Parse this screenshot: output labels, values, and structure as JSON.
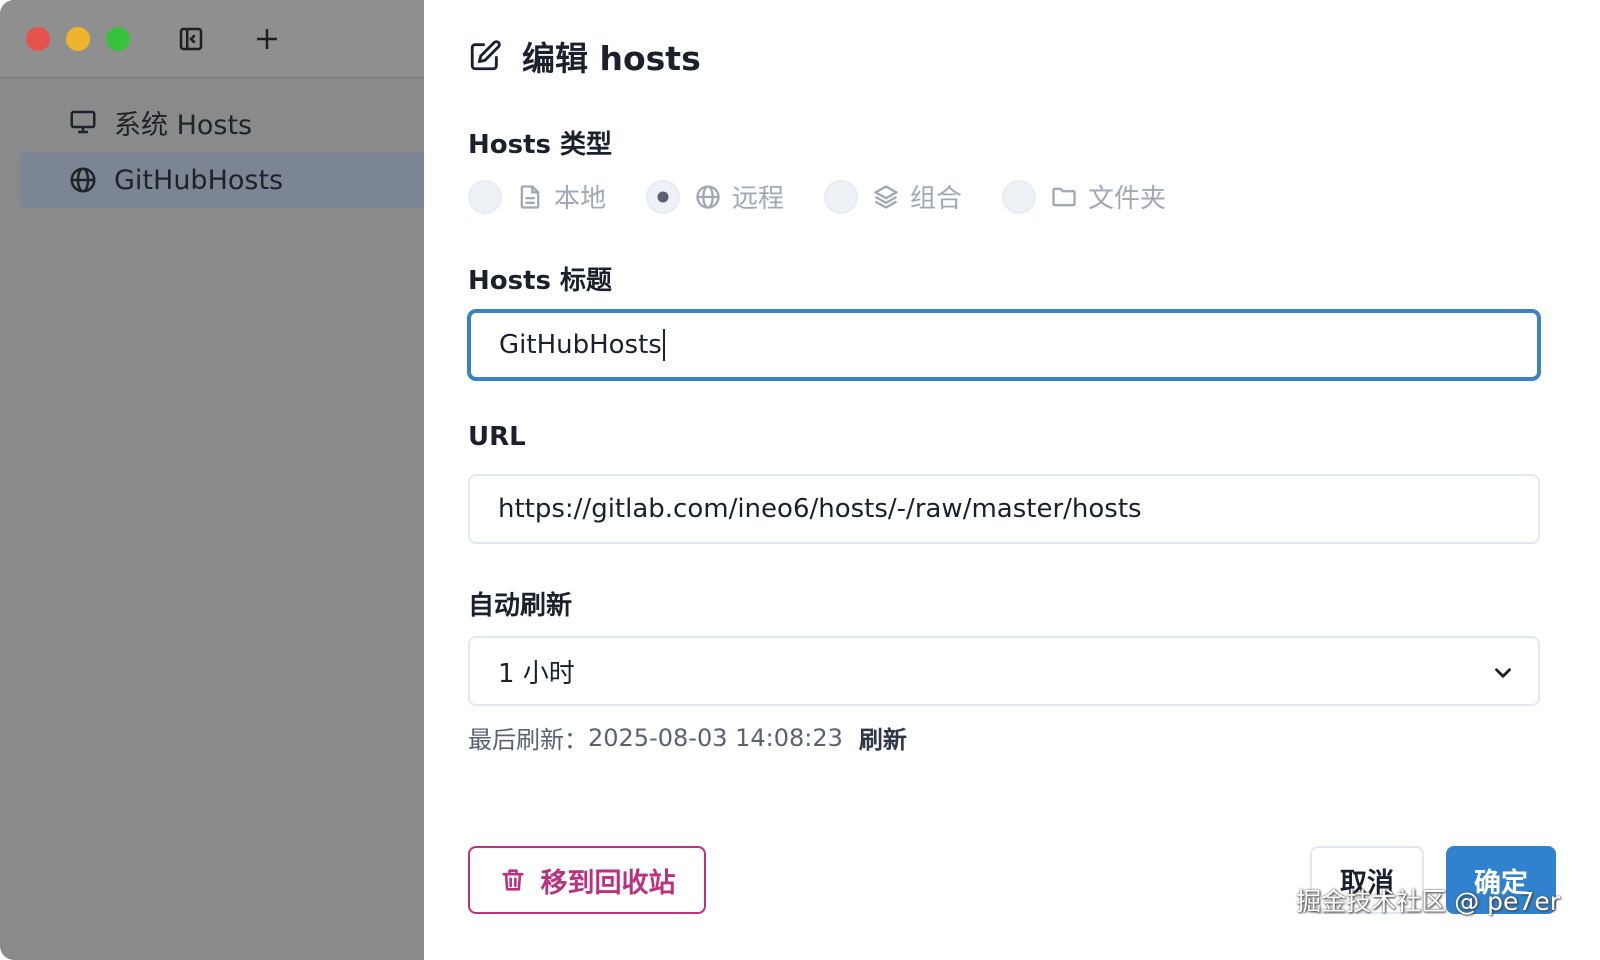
{
  "sidebar": {
    "items": [
      {
        "icon": "monitor-icon",
        "label": "系统 Hosts",
        "active": false
      },
      {
        "icon": "globe-icon",
        "label": "GitHubHosts",
        "active": true
      }
    ]
  },
  "dialog": {
    "title": "编辑 hosts",
    "type_label": "Hosts 类型",
    "types": [
      {
        "icon": "document-icon",
        "label": "本地",
        "selected": false
      },
      {
        "icon": "globe-icon",
        "label": "远程",
        "selected": true
      },
      {
        "icon": "layers-icon",
        "label": "组合",
        "selected": false
      },
      {
        "icon": "folder-icon",
        "label": "文件夹",
        "selected": false
      }
    ],
    "title_label": "Hosts 标题",
    "title_value": "GitHubHosts",
    "url_label": "URL",
    "url_value": "https://gitlab.com/ineo6/hosts/-/raw/master/hosts",
    "refresh_label": "自动刷新",
    "refresh_value": "1 小时",
    "last_refresh_label": "最后刷新：",
    "last_refresh_time": "2025-08-03 14:08:23",
    "refresh_link": "刷新",
    "trash_button": "移到回收站",
    "cancel_button": "取消",
    "ok_button": "确定"
  },
  "watermark": "掘金技术社区 @ pe7er",
  "colors": {
    "accent": "#3182ce",
    "danger": "#b83280",
    "focus_border": "#3b82c4"
  }
}
